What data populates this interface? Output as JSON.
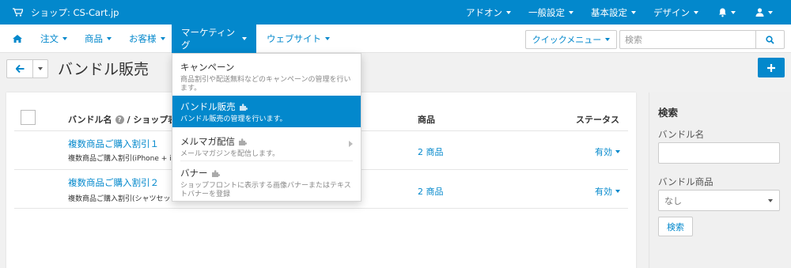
{
  "topbar": {
    "store_label": "ショップ: CS-Cart.jp",
    "menus": [
      "アドオン",
      "一般設定",
      "基本設定",
      "デザイン"
    ]
  },
  "nav": {
    "items": [
      "注文",
      "商品",
      "お客様",
      "マーケティング",
      "ウェブサイト"
    ],
    "quick_menu": "クイックメニュー",
    "search_placeholder": "検索"
  },
  "page": {
    "title": "バンドル販売"
  },
  "table": {
    "headers": {
      "name": "バンドル名",
      "shop_prefix": "/ ショップ表",
      "products": "商品",
      "status": "ステータス"
    },
    "rows": [
      {
        "name": "複数商品ご購入割引１",
        "description": "複数商品ご購入割引(iPhone + iPa",
        "products": "2 商品",
        "status": "有効"
      },
      {
        "name": "複数商品ご購入割引２",
        "description": "複数商品ご購入割引(シャツセット",
        "products": "2 商品",
        "status": "有効"
      }
    ]
  },
  "sidebar": {
    "title": "検索",
    "bundle_name_label": "バンドル名",
    "bundle_product_label": "バンドル商品",
    "bundle_product_value": "なし",
    "search_button": "検索"
  },
  "dropdown": {
    "items": [
      {
        "title": "キャンペーン",
        "desc1": "商品割引や配送無料などのキャンペーンの管理を行い",
        "desc2": "ます。"
      },
      {
        "title": "バンドル販売",
        "desc1": "バンドル販売の管理を行います。",
        "desc2": ""
      },
      {
        "title": "メルマガ配信",
        "desc1": "メールマガジンを配信します。",
        "desc2": ""
      },
      {
        "title": "バナー",
        "desc1": "ショップフロントに表示する画像バナーまたはテキス",
        "desc2": "トバナーを登録"
      }
    ]
  },
  "colors": {
    "brand": "#0388cc",
    "background": "#f1f1f1"
  }
}
